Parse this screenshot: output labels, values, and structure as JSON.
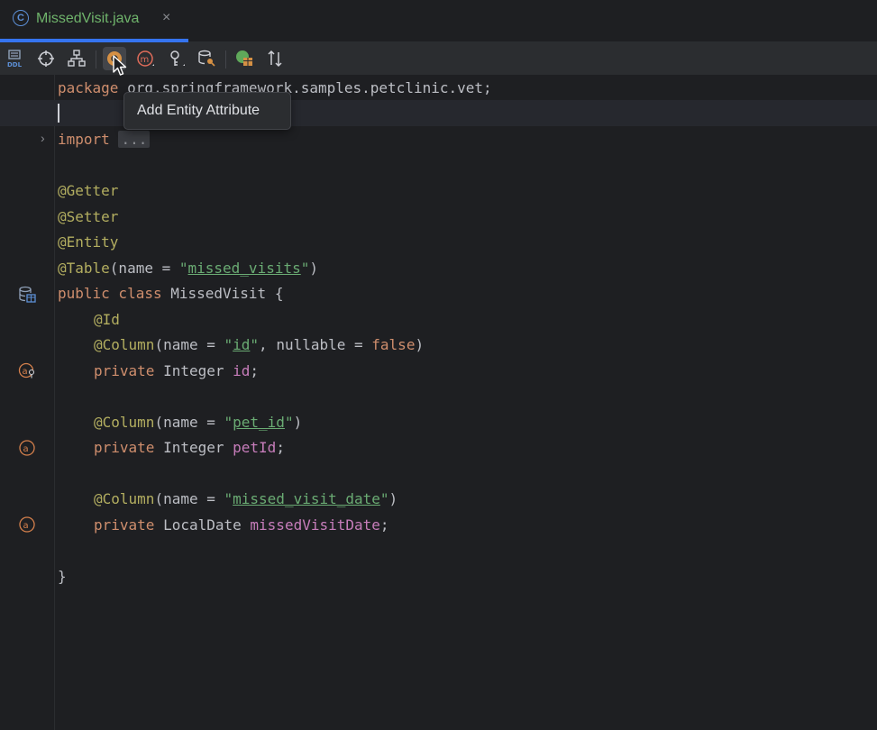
{
  "tab": {
    "title": "MissedVisit.java",
    "icon_letter": "C",
    "close_glyph": "×"
  },
  "toolbar": {
    "ddl_label": "DDL",
    "items": [
      "ddl-icon",
      "crosshair-icon",
      "hierarchy-icon",
      "entity-attribute-icon",
      "method-icon",
      "key-icon",
      "db-search-icon",
      "db-table-icon",
      "sort-icon"
    ]
  },
  "tooltip": {
    "text": "Add Entity Attribute"
  },
  "code": {
    "package_kw": "package",
    "package_name": " org.springframework.samples.petclinic.vet;",
    "import_kw": "import",
    "import_fold": "...",
    "ann_getter": "@Getter",
    "ann_setter": "@Setter",
    "ann_entity": "@Entity",
    "ann_table": "@Table",
    "table_args_open": "(name = ",
    "table_name": "missed_visits",
    "table_args_close": ")",
    "class_public": "public",
    "class_kw": " class",
    "class_name": " MissedVisit {",
    "ann_id": "@Id",
    "ann_column": "@Column",
    "col_id_open": "(name = ",
    "col_id_name": "id",
    "col_id_mid": ", nullable = ",
    "col_id_false": "false",
    "col_id_close": ")",
    "field_private": "private",
    "field_id_type": " Integer ",
    "field_id_name": "id",
    "semicolon": ";",
    "col_pet_open": "(name = ",
    "col_pet_name": "pet_id",
    "col_pet_close": ")",
    "field_pet_type": " Integer ",
    "field_pet_name": "petId",
    "col_date_open": "(name = ",
    "col_date_name": "missed_visit_date",
    "col_date_close": ")",
    "field_date_type": " LocalDate ",
    "field_date_name": "missedVisitDate",
    "close_brace": "}",
    "quote": "\""
  },
  "colors": {
    "keyword": "#cf8e6d",
    "annotation": "#b3ae60",
    "string": "#6aab73",
    "field": "#c77dbb",
    "accent": "#3574f0"
  }
}
